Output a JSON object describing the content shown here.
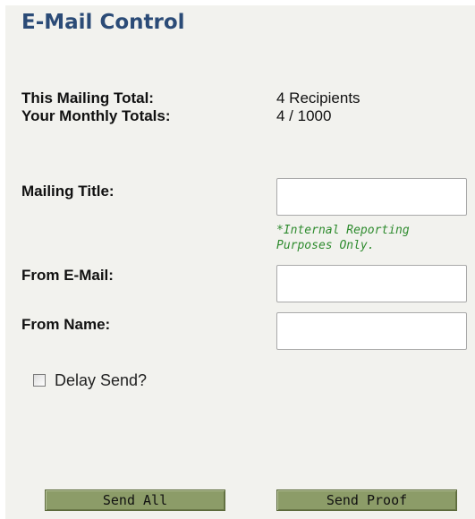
{
  "header": {
    "title": "E-Mail Control"
  },
  "stats": {
    "mailing_total_label": "This Mailing Total:",
    "mailing_total_value": "4 Recipients",
    "monthly_totals_label": "Your Monthly Totals:",
    "monthly_totals_value": "4 / 1000"
  },
  "form": {
    "mailing_title_label": "Mailing Title:",
    "mailing_title_value": "",
    "mailing_title_note": "*Internal Reporting Purposes Only.",
    "from_email_label": "From E-Mail:",
    "from_email_value": "",
    "from_name_label": "From Name:",
    "from_name_value": "",
    "delay_send_label": "Delay Send?",
    "delay_send_checked": false
  },
  "buttons": {
    "send_all_label": "Send All",
    "send_proof_label": "Send Proof"
  },
  "colors": {
    "title": "#2b4b77",
    "note": "#2e8b2e",
    "button_bg": "#8c9c68",
    "panel_bg": "#f2f2ee"
  }
}
